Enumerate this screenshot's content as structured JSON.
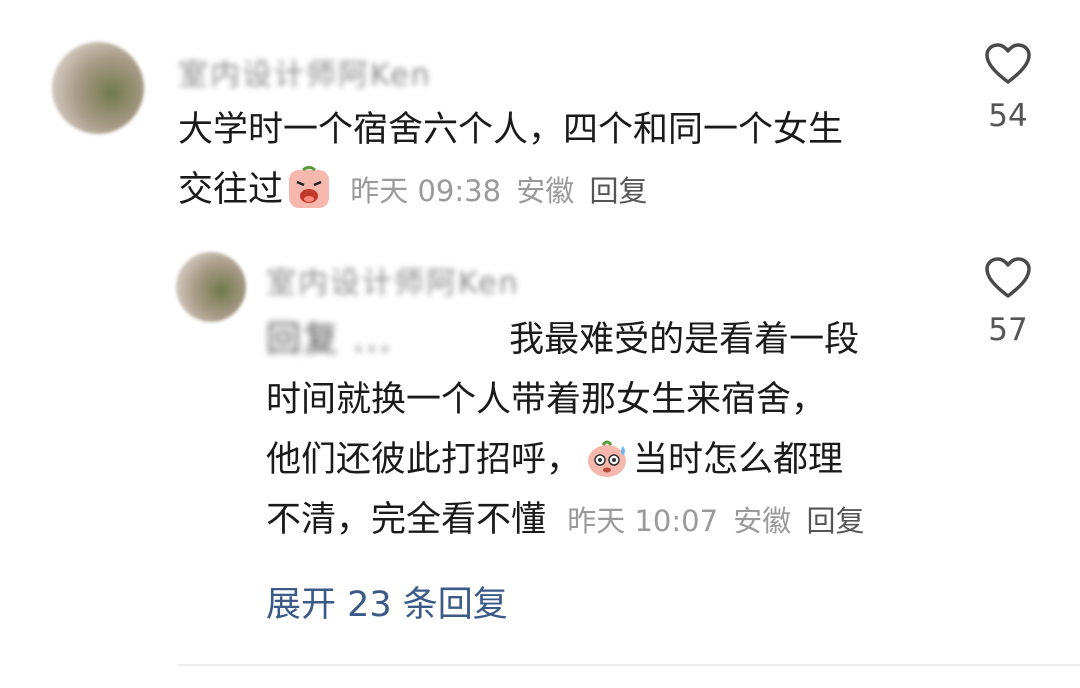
{
  "comment": {
    "author": "室内设计师阿Ken",
    "text_line1": "大学时一个宿舍六个人，四个和同一个女生",
    "text_line2": "交往过",
    "emoji": "crying-face-emoji",
    "time": "昨天 09:38",
    "location": "安徽",
    "reply_label": "回复",
    "likes": "54"
  },
  "reply": {
    "author": "室内设计师阿Ken",
    "mention": "回复 ...",
    "line1": "我最难受的是看着一段",
    "line2": "时间就换一个人带着那女生来宿舍，",
    "line3a": "他们还彼此打招呼，",
    "emoji": "sweating-face-emoji",
    "line3b": "当时怎么都理",
    "line4": "不清，完全看不懂",
    "time": "昨天 10:07",
    "location": "安徽",
    "reply_label": "回复",
    "likes": "57"
  },
  "expand_label": "展开 23 条回复"
}
